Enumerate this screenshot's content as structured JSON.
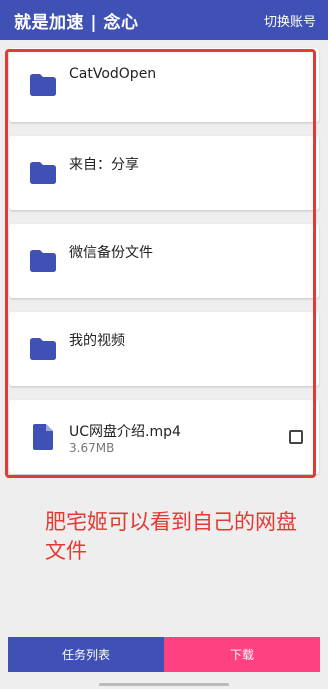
{
  "appbar": {
    "title": "就是加速 | 念心",
    "action": "切换账号"
  },
  "items": [
    {
      "type": "folder",
      "name": "CatVodOpen",
      "icon": "folder-icon"
    },
    {
      "type": "folder",
      "name": "来自：分享",
      "icon": "folder-icon"
    },
    {
      "type": "folder",
      "name": "微信备份文件",
      "icon": "folder-icon"
    },
    {
      "type": "folder",
      "name": "我的视频",
      "icon": "folder-icon"
    },
    {
      "type": "file",
      "name": "UC网盘介绍.mp4",
      "size": "3.67MB",
      "icon": "file-icon",
      "checked": false
    }
  ],
  "annotation": "肥宅姬可以看到自己的网盘文件",
  "bottom": {
    "left_label": "任务列表",
    "right_label": "下载"
  },
  "colors": {
    "primary": "#3f51b5",
    "accent": "#ff4081",
    "annotation": "#e53935"
  }
}
